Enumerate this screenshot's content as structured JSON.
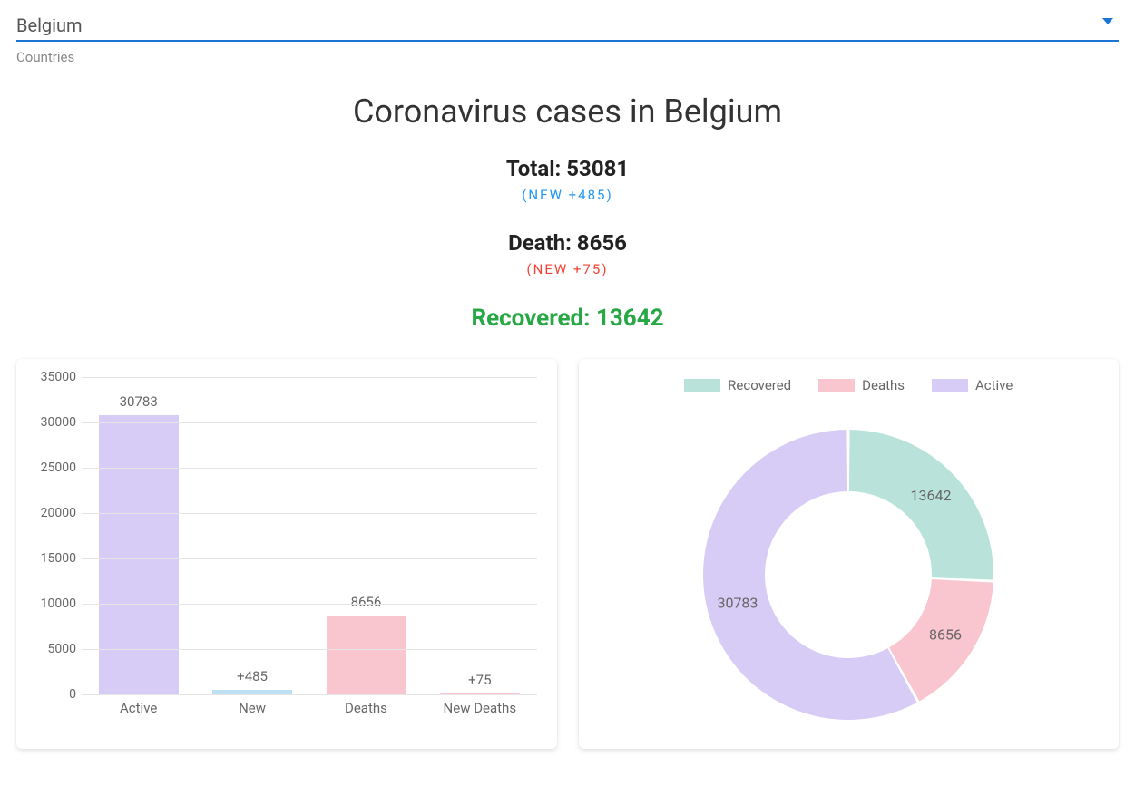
{
  "select": {
    "label": "Countries",
    "value": "Belgium"
  },
  "title": "Coronavirus cases in Belgium",
  "stats": {
    "total_label": "Total: 53081",
    "total_new": "(NEW +485)",
    "death_label": "Death: 8656",
    "death_new": "(NEW +75)",
    "recovered_label": "Recovered: 13642"
  },
  "colors": {
    "active": "#d7ccf5",
    "new": "#bde0f2",
    "deaths": "#f9c5cf",
    "recovered": "#b9e3da"
  },
  "chart_data": [
    {
      "type": "bar",
      "categories": [
        "Active",
        "New",
        "Deaths",
        "New Deaths"
      ],
      "values": [
        30783,
        485,
        8656,
        75
      ],
      "value_labels": [
        "30783",
        "+485",
        "8656",
        "+75"
      ],
      "bar_colors": [
        "#d7ccf5",
        "#bde0f2",
        "#f9c5cf",
        "#f9c5cf"
      ],
      "ylim": [
        0,
        35000
      ],
      "ystep": 5000
    },
    {
      "type": "pie",
      "series": [
        {
          "name": "Recovered",
          "value": 13642,
          "color": "#b9e3da"
        },
        {
          "name": "Deaths",
          "value": 8656,
          "color": "#f9c5cf"
        },
        {
          "name": "Active",
          "value": 30783,
          "color": "#d7ccf5"
        }
      ],
      "donut": true
    }
  ]
}
